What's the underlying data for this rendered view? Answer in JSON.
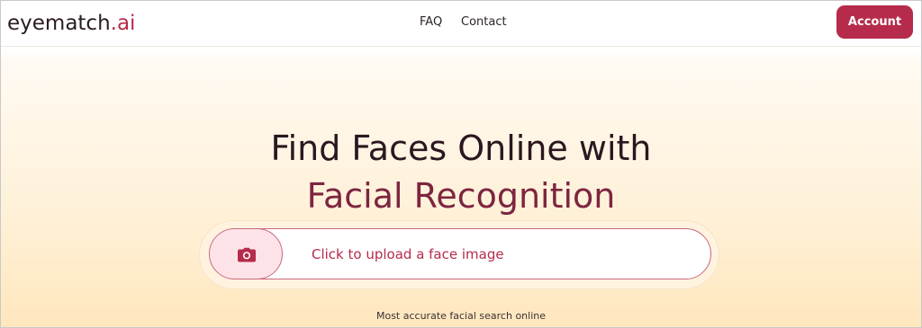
{
  "header": {
    "logo_main": "eyematch",
    "logo_accent": ".ai",
    "nav": {
      "faq": "FAQ",
      "contact": "Contact"
    },
    "account_label": "Account"
  },
  "hero": {
    "title_line1": "Find Faces Online with",
    "title_line2": "Facial Recognition"
  },
  "upload": {
    "label": "Click to upload a face image",
    "icon": "camera-icon"
  },
  "tagline": "Most accurate facial search online",
  "colors": {
    "brand": "#b62b4b",
    "title": "#2b1720",
    "title_accent": "#7d2540",
    "background_top": "#ffffff",
    "background_bottom": "#ffe7bd"
  }
}
